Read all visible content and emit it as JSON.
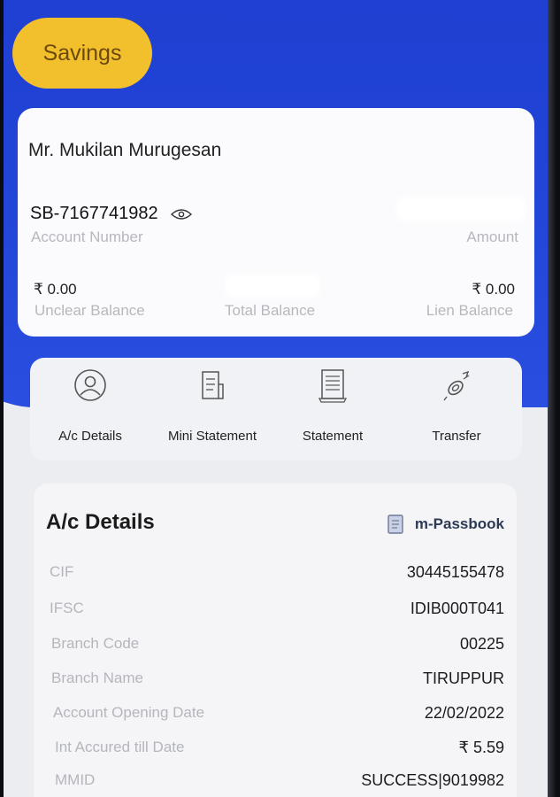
{
  "account_type_chip": "Savings",
  "account_card": {
    "holder_name": "Mr. Mukilan Murugesan",
    "account_number": "SB-7167741982",
    "account_number_label": "Account Number",
    "amount_label": "Amount",
    "unclear_balance": "₹ 0.00",
    "unclear_balance_label": "Unclear Balance",
    "total_balance_label": "Total Balance",
    "lien_balance": "₹ 0.00",
    "lien_balance_label": "Lien Balance"
  },
  "quick_actions": [
    {
      "label": "A/c Details",
      "icon": "user-circle-icon"
    },
    {
      "label": "Mini Statement",
      "icon": "receipt-icon"
    },
    {
      "label": "Statement",
      "icon": "document-icon"
    },
    {
      "label": "Transfer",
      "icon": "transfer-icon"
    }
  ],
  "details": {
    "title": "A/c Details",
    "passbook_label": "m-Passbook",
    "rows": [
      {
        "label": "CIF",
        "value": "30445155478"
      },
      {
        "label": "IFSC",
        "value": "IDIB000T041"
      },
      {
        "label": "Branch Code",
        "value": "00225"
      },
      {
        "label": "Branch Name",
        "value": "TIRUPPUR"
      },
      {
        "label": "Account Opening Date",
        "value": "22/02/2022"
      },
      {
        "label": "Int Accured till Date",
        "value": "₹ 5.59"
      },
      {
        "label": "MMID",
        "value": "SUCCESS|9019982"
      }
    ]
  },
  "colors": {
    "header_blue": "#2347d9",
    "chip_yellow": "#f3c02d",
    "card_white": "#fbfbfd"
  }
}
